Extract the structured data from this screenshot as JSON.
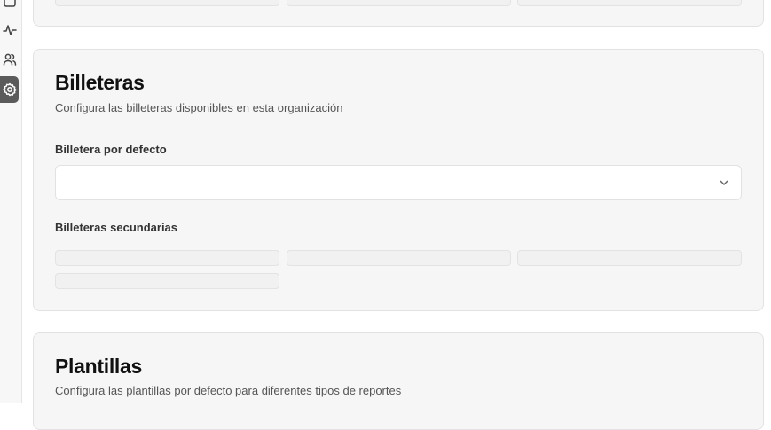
{
  "sidebar": {
    "items": [
      {
        "icon": "calendar-icon"
      },
      {
        "icon": "activity-icon"
      },
      {
        "icon": "users-icon"
      },
      {
        "icon": "settings-icon",
        "active": true
      }
    ]
  },
  "wallets": {
    "title": "Billeteras",
    "description": "Configura las billeteras disponibles en esta organización",
    "default_label": "Billetera por defecto",
    "default_value": "",
    "secondary_label": "Billeteras secundarias"
  },
  "templates": {
    "title": "Plantillas",
    "description": "Configura las plantillas por defecto para diferentes tipos de reportes"
  },
  "colors": {
    "card_bg": "#f6f6f6",
    "active_icon_bg": "#5b5b5b"
  }
}
